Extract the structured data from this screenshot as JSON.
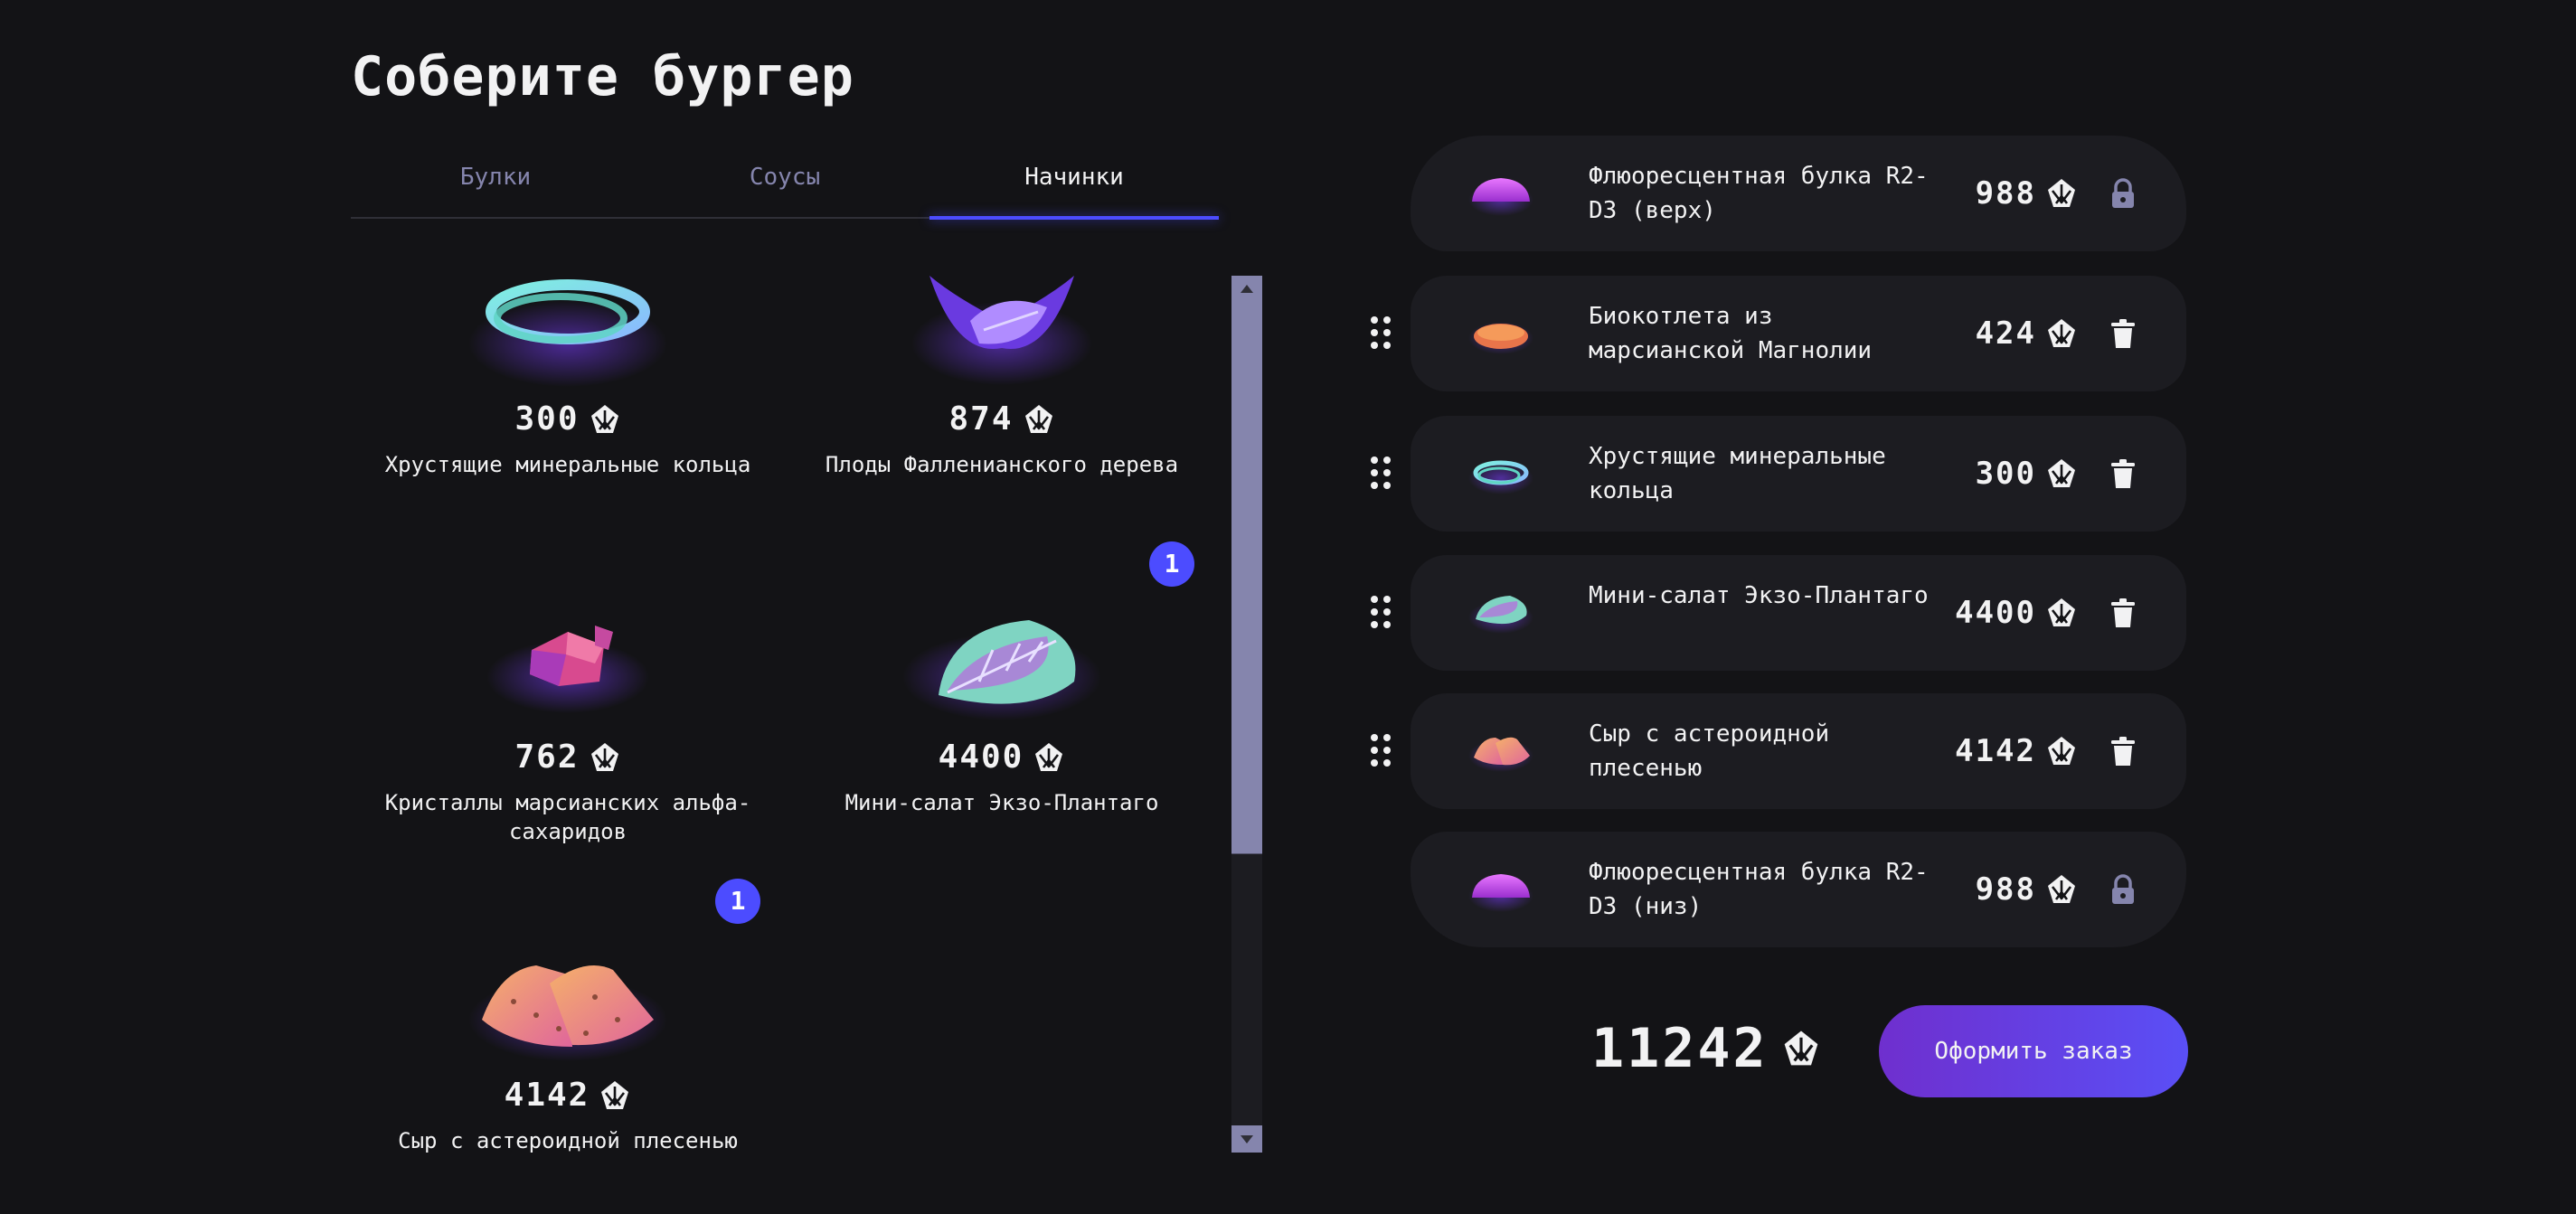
{
  "page": {
    "title": "Соберите бургер"
  },
  "tabs": [
    {
      "label": "Булки",
      "active": false
    },
    {
      "label": "Соусы",
      "active": false
    },
    {
      "label": "Начинки",
      "active": true
    }
  ],
  "ingredients": [
    {
      "name": "Хрустящие минеральные кольца",
      "price": "300",
      "icon": "mineral-rings-icon"
    },
    {
      "name": "Плоды Фалленианского дерева",
      "price": "874",
      "icon": "fallenian-fruit-icon"
    },
    {
      "name": "Кристаллы марсианских альфа-сахаридов",
      "price": "762",
      "icon": "crystals-icon"
    },
    {
      "name": "Мини-салат Экзо-Плантаго",
      "price": "4400",
      "count": "1",
      "icon": "salad-leaf-icon"
    },
    {
      "name": "Сыр с астероидной плесенью",
      "price": "4142",
      "count": "1",
      "icon": "cheese-icon"
    }
  ],
  "constructor": {
    "items": [
      {
        "name": "Флюоресцентная булка R2-D3 (верх)",
        "price": "988",
        "locked": true,
        "icon": "bun-icon"
      },
      {
        "name": "Биокотлета из марсианской Магнолии",
        "price": "424",
        "locked": false,
        "icon": "cutlet-icon"
      },
      {
        "name": "Хрустящие минеральные кольца",
        "price": "300",
        "locked": false,
        "icon": "mineral-rings-icon"
      },
      {
        "name": "Мини-салат Экзо-Плантаго",
        "price": "4400",
        "locked": false,
        "icon": "salad-leaf-icon"
      },
      {
        "name": "Сыр с астероидной плесенью",
        "price": "4142",
        "locked": false,
        "icon": "cheese-icon"
      },
      {
        "name": "Флюоресцентная булка R2-D3 (низ)",
        "price": "988",
        "locked": true,
        "icon": "bun-icon"
      }
    ],
    "total": "11242",
    "order_label": "Оформить заказ"
  },
  "colors": {
    "accent": "#4c4cff",
    "background": "#131316",
    "card": "#1c1c21",
    "muted": "#8585ad"
  }
}
